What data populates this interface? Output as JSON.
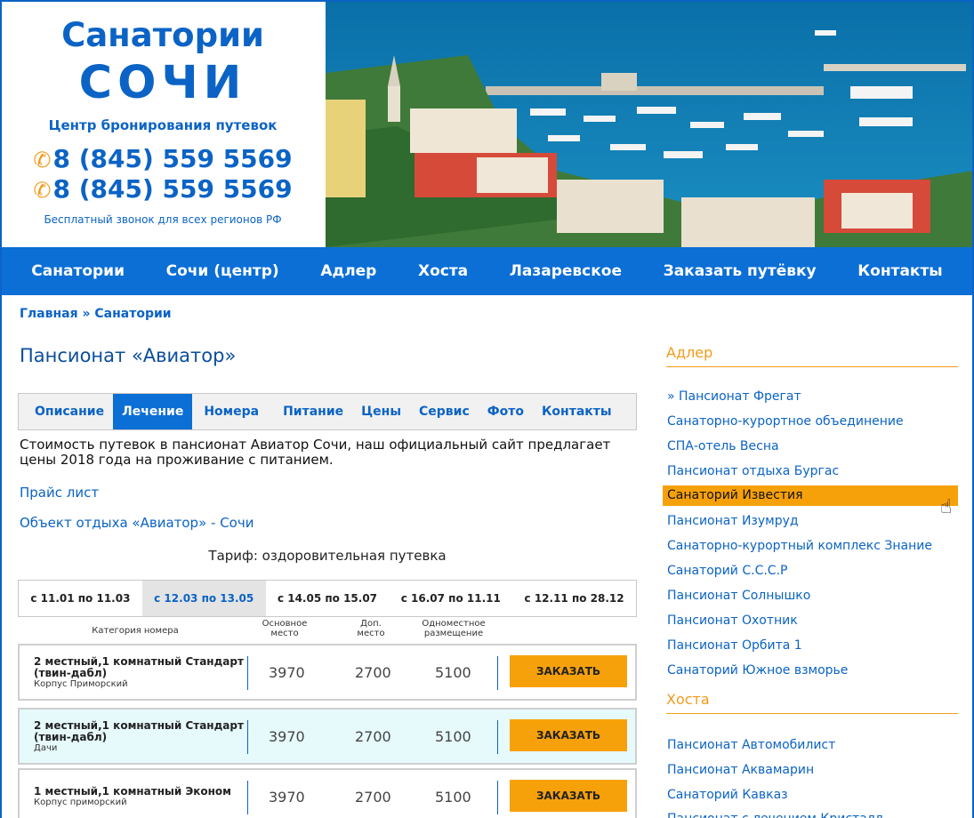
{
  "brand": {
    "title_line1": "Санатории",
    "title_line2": "СОЧИ",
    "subtitle": "Центр бронирования путевок",
    "phone1": "8 (845) 559 5569",
    "phone2": "8 (845) 559 5569",
    "note": "Бесплатный звонок для всех регионов РФ",
    "phone_icon": "phone-icon"
  },
  "hero": {
    "image": "sochi-harbor-photo"
  },
  "nav": [
    "Санатории",
    "Сочи (центр)",
    "Адлер",
    "Хоста",
    "Лазаревское",
    "Заказать путёвку",
    "Контакты"
  ],
  "breadcrumb": {
    "home": "Главная",
    "sep": " » ",
    "current": "Санатории"
  },
  "page_title": "Пансионат «Авиатор»",
  "tabs": [
    "Описание",
    "Лечение",
    "Номера",
    "Питание",
    "Цены",
    "Сервис",
    "Фото",
    "Контакты"
  ],
  "active_tab": "Лечение",
  "intro": "Стоимость путевок в пансионат Авиатор Сочи, наш официальный сайт предлагает цены 2018 года на проживание с питанием.",
  "link_price": "Прайс лист",
  "link_object": "Объект отдыха «Авиатор» - Сочи",
  "tariff": "Тариф: оздоровительная путевка",
  "periods": [
    "с 11.01 по 11.03",
    "с 12.03 по 13.05",
    "с 14.05 по 15.07",
    "с 16.07 по 11.11",
    "с 12.11 по 28.12"
  ],
  "columns": {
    "category": "Категория номера",
    "main_line1": "Основное",
    "main_line2": "место",
    "extra_line1": "Доп.",
    "extra_line2": "место",
    "single_line1": "Одноместное",
    "single_line2": "размещение"
  },
  "rooms": [
    {
      "name": "2 местный,1 комнатный Стандарт (твин-дабл)",
      "building": "Корпус Приморский",
      "main": "3970",
      "extra": "2700",
      "single": "5100",
      "button": "ЗАКАЗАТЬ"
    },
    {
      "name": "2 местный,1 комнатный Стандарт (твин-дабл)",
      "building": "Дачи",
      "main": "3970",
      "extra": "2700",
      "single": "5100",
      "button": "ЗАКАЗАТЬ"
    },
    {
      "name": "1 местный,1 комнатный Эконом",
      "building": "Корпус приморский",
      "main": "3970",
      "extra": "2700",
      "single": "5100",
      "button": "ЗАКАЗАТЬ"
    }
  ],
  "sidebar": {
    "adler_heading": "Адлер",
    "adler_items": [
      "» Пансионат Фрегат",
      "Санаторно-курортное объединение",
      "СПА-отель Весна",
      "Пансионат отдыха Бургас",
      "Санаторий Известия",
      "Пансионат Изумруд",
      "Санаторно-курортный комплекс Знание",
      "Санаторий С.С.С.Р",
      "Пансионат Солнышко",
      "Пансионат Охотник",
      "Пансионат Орбита 1",
      "Санаторий Южное взморье"
    ],
    "hosta_heading": "Хоста",
    "hosta_items": [
      "Пансионат Автомобилист",
      "Пансионат Аквамарин",
      "Санаторий Кавказ",
      "Пансионат с лечением Кристалл"
    ]
  },
  "colors": {
    "brand_blue": "#0b63c5",
    "nav_blue": "#0b6fd6",
    "accent_orange": "#f7a10a"
  }
}
